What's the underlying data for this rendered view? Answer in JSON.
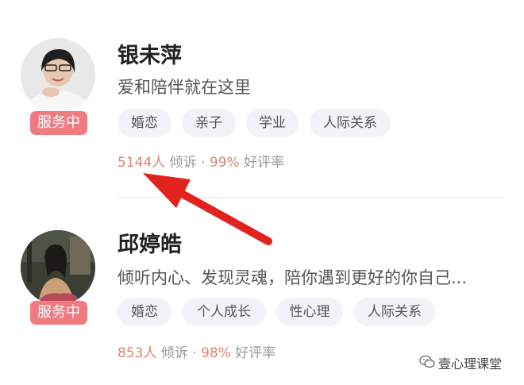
{
  "counselors": [
    {
      "name": "银未萍",
      "bio": "爱和陪伴就在这里",
      "status": "服务中",
      "tags": [
        "婚恋",
        "亲子",
        "学业",
        "人际关系"
      ],
      "consult_count": "5144人",
      "consult_label": "倾诉",
      "separator": "·",
      "rating": "99%",
      "rating_label": "好评率"
    },
    {
      "name": "邱婷皓",
      "bio": "倾听内心、发现灵魂，陪你遇到更好的你自己...",
      "status": "服务中",
      "tags": [
        "婚恋",
        "个人成长",
        "性心理",
        "人际关系"
      ],
      "consult_count": "853人",
      "consult_label": "倾诉",
      "separator": "·",
      "rating": "98%",
      "rating_label": "好评率"
    }
  ],
  "watermark": {
    "text": "壹心理课堂",
    "icon": "wechat-icon"
  },
  "colors": {
    "badge": "#ef7a80",
    "highlight": "#d98471",
    "tag_bg": "#f1f3f7",
    "arrow": "#e0231c"
  }
}
